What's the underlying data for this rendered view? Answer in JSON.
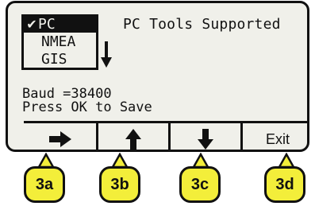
{
  "menu": {
    "items": [
      {
        "label": "PC",
        "checked": true,
        "selected": true
      },
      {
        "label": "NMEA",
        "checked": false,
        "selected": false
      },
      {
        "label": "GIS",
        "checked": false,
        "selected": false
      }
    ],
    "check_glyph": "✔",
    "scroll_icon": "down-arrow-icon"
  },
  "header": {
    "title": "PC Tools Supported"
  },
  "status": {
    "baud_line": "Baud =38400",
    "hint_line": "Press OK to Save"
  },
  "softkeys": [
    {
      "icon": "right-arrow-icon",
      "label": ""
    },
    {
      "icon": "up-arrow-icon",
      "label": ""
    },
    {
      "icon": "down-arrow-icon",
      "label": ""
    },
    {
      "icon": "",
      "label": "Exit"
    }
  ],
  "hardware_buttons": [
    "3a",
    "3b",
    "3c",
    "3d"
  ],
  "colors": {
    "screen": "#f0f0ea",
    "ink": "#111111",
    "button": "#f3ee3a"
  }
}
